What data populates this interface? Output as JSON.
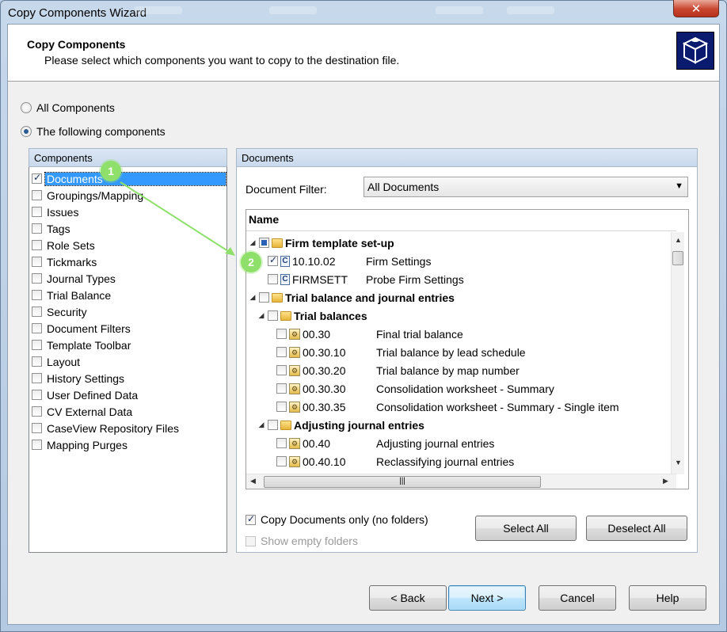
{
  "window": {
    "title": "Copy Components Wizard",
    "close_glyph": "✕"
  },
  "header": {
    "title": "Copy Components",
    "subtitle": "Please select which components you want to copy to the destination file."
  },
  "options": {
    "all_components": {
      "label": "All Components",
      "selected": false
    },
    "following_components": {
      "label": "The following components",
      "selected": true
    }
  },
  "components_panel": {
    "header": "Components",
    "items": [
      {
        "label": "Documents",
        "checked": true,
        "selected": true
      },
      {
        "label": "Groupings/Mapping",
        "checked": false
      },
      {
        "label": "Issues",
        "checked": false
      },
      {
        "label": "Tags",
        "checked": false
      },
      {
        "label": "Role Sets",
        "checked": false
      },
      {
        "label": "Tickmarks",
        "checked": false
      },
      {
        "label": "Journal Types",
        "checked": false
      },
      {
        "label": "Trial Balance",
        "checked": false
      },
      {
        "label": "Security",
        "checked": false
      },
      {
        "label": "Document Filters",
        "checked": false
      },
      {
        "label": "Template Toolbar",
        "checked": false
      },
      {
        "label": "Layout",
        "checked": false
      },
      {
        "label": "History Settings",
        "checked": false
      },
      {
        "label": "User Defined Data",
        "checked": false
      },
      {
        "label": "CV External Data",
        "checked": false
      },
      {
        "label": "CaseView Repository Files",
        "checked": false
      },
      {
        "label": "Mapping Purges",
        "checked": false
      }
    ]
  },
  "documents_panel": {
    "header": "Documents",
    "filter_label": "Document Filter:",
    "filter_value": "All Documents",
    "tree_header": "Name",
    "rows": [
      {
        "type": "folder",
        "level": 0,
        "name": "Firm template set-up",
        "state": "partial"
      },
      {
        "type": "doc-c",
        "level": 1,
        "ref": "10.10.02",
        "name": "Firm Settings",
        "state": "checked"
      },
      {
        "type": "doc-c",
        "level": 1,
        "ref": "FIRMSETT",
        "name": "Probe Firm Settings",
        "state": "unchecked"
      },
      {
        "type": "folder",
        "level": 0,
        "name": "Trial balance and journal entries",
        "state": "unchecked"
      },
      {
        "type": "folder",
        "level": 1,
        "name": "Trial balances",
        "state": "unchecked"
      },
      {
        "type": "doc-e",
        "level": 2,
        "ref": "00.30",
        "name": "Final trial balance",
        "state": "unchecked"
      },
      {
        "type": "doc-e",
        "level": 2,
        "ref": "00.30.10",
        "name": "Trial balance by lead schedule",
        "state": "unchecked"
      },
      {
        "type": "doc-e",
        "level": 2,
        "ref": "00.30.20",
        "name": "Trial balance by map number",
        "state": "unchecked"
      },
      {
        "type": "doc-e",
        "level": 2,
        "ref": "00.30.30",
        "name": "Consolidation worksheet - Summary",
        "state": "unchecked"
      },
      {
        "type": "doc-e",
        "level": 2,
        "ref": "00.30.35",
        "name": "Consolidation worksheet - Summary - Single item",
        "state": "unchecked"
      },
      {
        "type": "folder",
        "level": 1,
        "name": "Adjusting journal entries",
        "state": "unchecked"
      },
      {
        "type": "doc-e",
        "level": 2,
        "ref": "00.40",
        "name": "Adjusting journal entries",
        "state": "unchecked"
      },
      {
        "type": "doc-e",
        "level": 2,
        "ref": "00.40.10",
        "name": "Reclassifying journal entries",
        "state": "unchecked"
      }
    ],
    "copy_docs_only": {
      "label": "Copy Documents only (no folders)",
      "checked": true
    },
    "show_empty_folders": {
      "label": "Show empty folders",
      "checked": false,
      "enabled": false
    },
    "select_all": "Select All",
    "deselect_all": "Deselect All"
  },
  "footer": {
    "back": "< Back",
    "next": "Next >",
    "cancel": "Cancel",
    "help": "Help"
  },
  "annotations": {
    "badge1": "1",
    "badge2": "2",
    "color": "#8ee06a"
  }
}
